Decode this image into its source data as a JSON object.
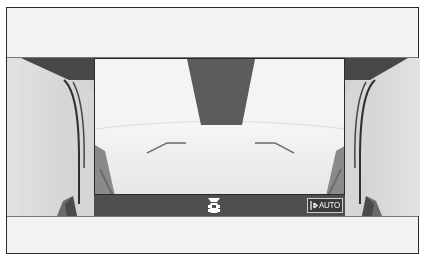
{
  "bottom_bar": {
    "view_mode_icon": "overhead-car-view-icon",
    "auto_button": {
      "icon": "camera-switch-icon",
      "label": "AUTO"
    }
  },
  "colors": {
    "screen_background": "#f1f1f1",
    "camera_bar": "#4f4f4f",
    "road": "#eeeeee",
    "overlay_lines": "#6a6a6a"
  }
}
